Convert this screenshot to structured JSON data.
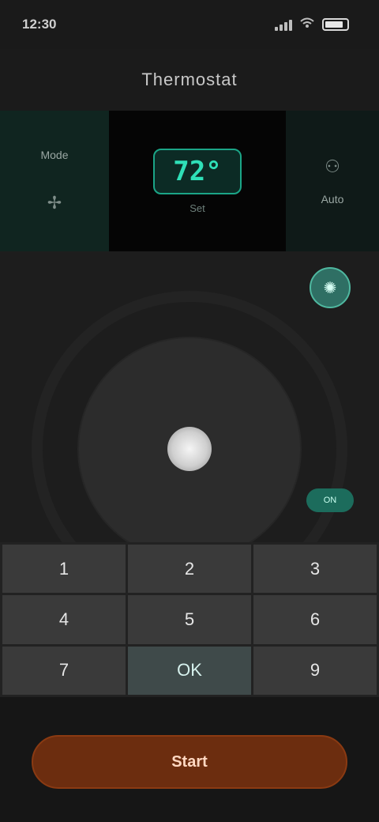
{
  "status_bar": {
    "time": "12:30",
    "battery_label": "",
    "icons": [
      "signal-icon",
      "wifi-icon",
      "battery-icon"
    ]
  },
  "header": {
    "title": "Thermostat"
  },
  "panel": {
    "left_label": "Mode",
    "left_icon": "fan-icon",
    "temperature": "72°",
    "unit": "Set",
    "right_label": "Auto",
    "right_icon": "user-icon"
  },
  "controls": {
    "side_button_icon": "bulb-icon",
    "small_button_label": "ON"
  },
  "keypad": {
    "keys": [
      "1",
      "2",
      "3",
      "4",
      "5",
      "6",
      "7",
      "OK",
      "9"
    ]
  },
  "bottom": {
    "row": [
      "",
      "",
      ""
    ],
    "cta_label": "Start"
  },
  "colors": {
    "accent": "#2fe0b8",
    "cta": "#6c2d0f"
  }
}
